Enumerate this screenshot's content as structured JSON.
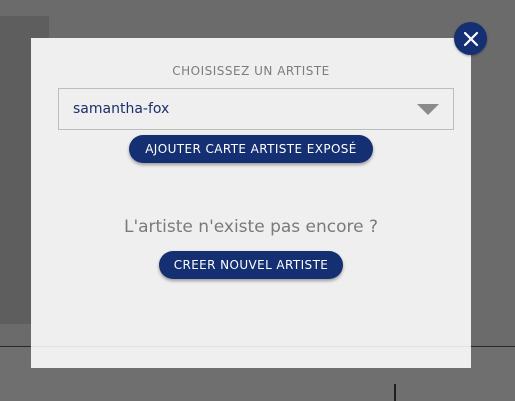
{
  "dialog": {
    "choose_label": "CHOISISSEZ UN ARTISTE",
    "selected_artist": "samantha-fox",
    "add_button_label": "AJOUTER CARTE ARTISTE EXPOSÉ",
    "question_text": "L'artiste n'existe pas encore ?",
    "create_button_label": "CREER NOUVEL ARTISTE"
  },
  "icons": {
    "close": "close-icon",
    "dropdown": "chevron-down-icon"
  },
  "colors": {
    "accent": "#142f72",
    "modal_background": "#efefef",
    "overlay": "#6b6b6b"
  }
}
